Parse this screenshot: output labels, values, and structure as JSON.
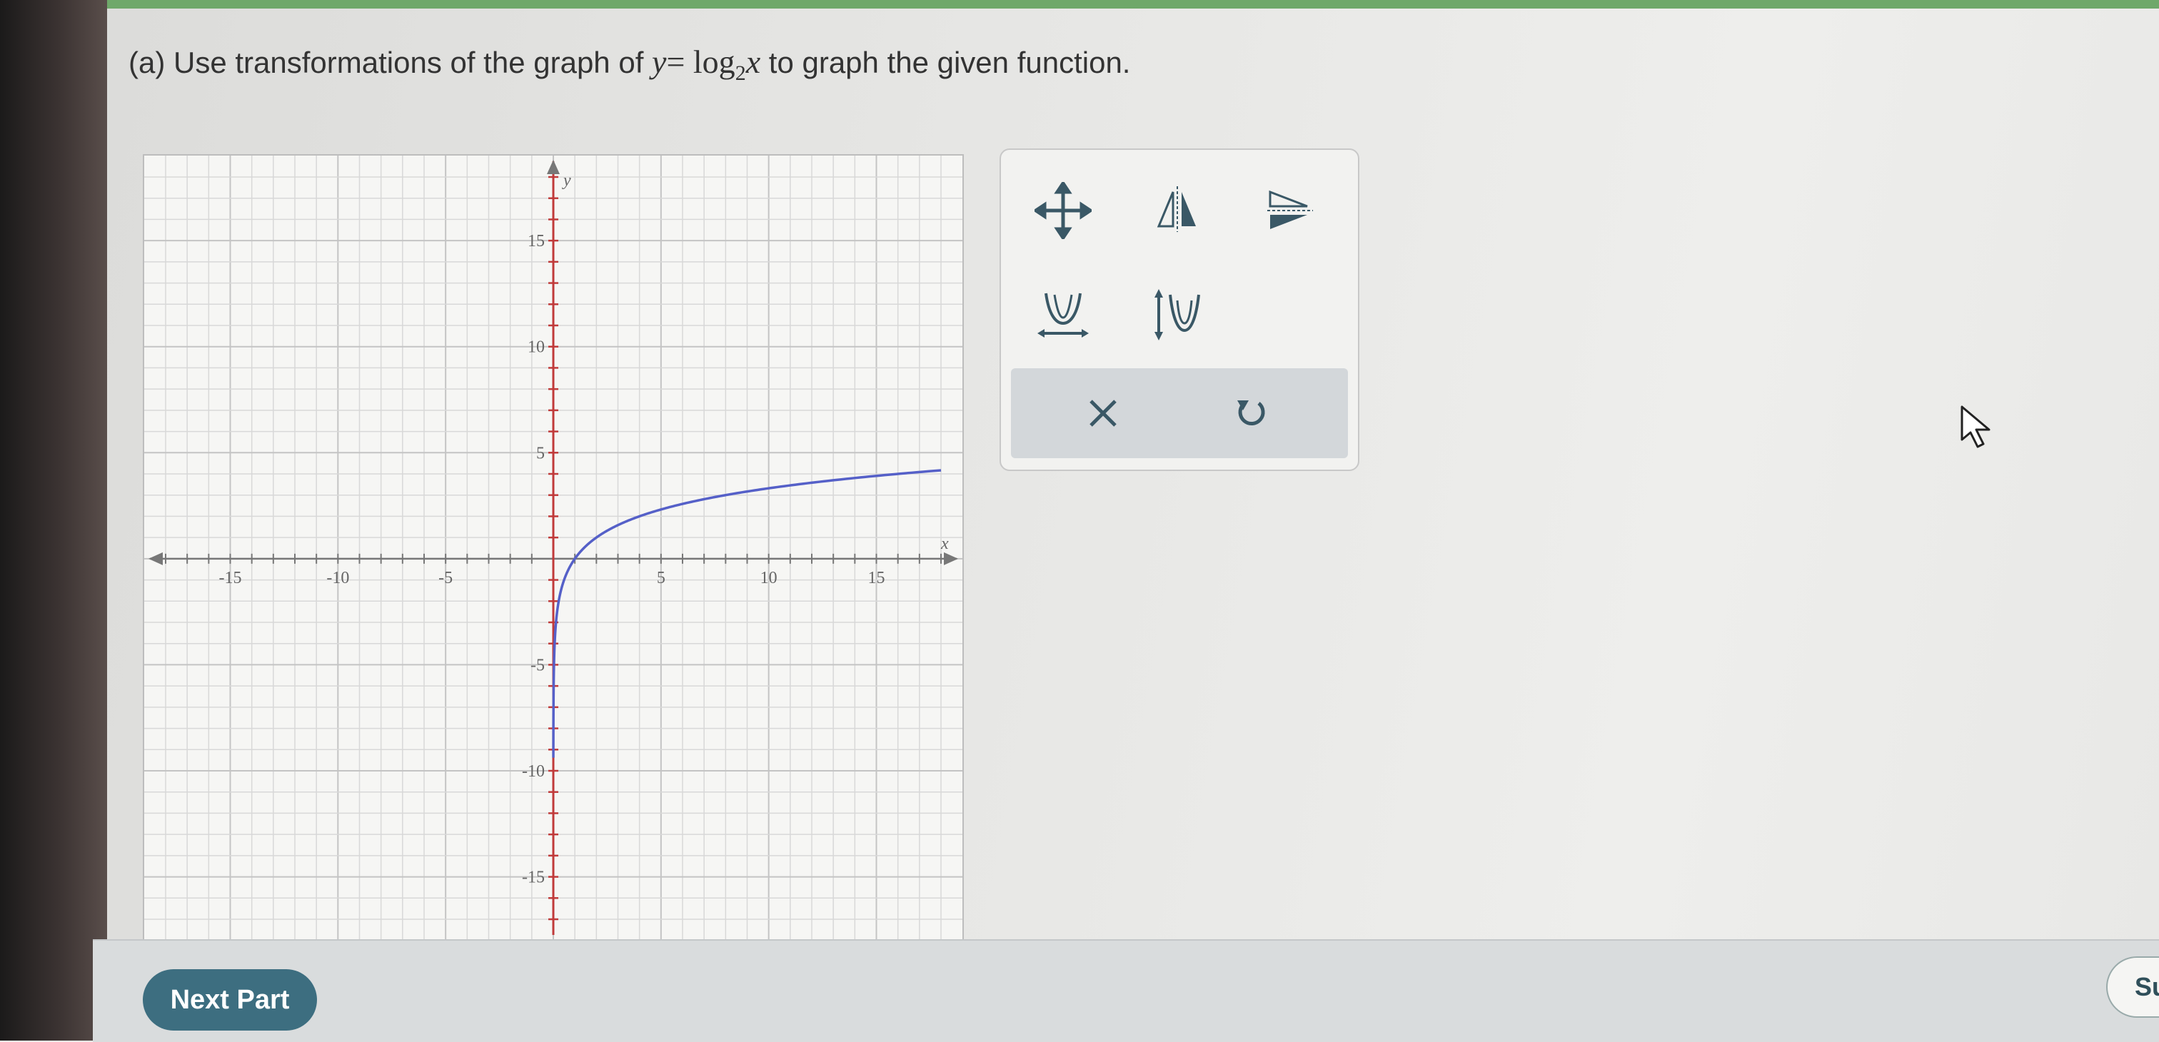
{
  "question": {
    "part": "(a)",
    "text_before": "Use transformations of the graph of",
    "equation_y": "y",
    "equation_eq": "=",
    "equation_log": "log",
    "equation_base": "2",
    "equation_x": "x",
    "text_after": "to graph the given function."
  },
  "toolbar": {
    "tools": [
      {
        "name": "move-tool",
        "icon": "move-arrows-icon"
      },
      {
        "name": "reflect-y-axis-tool",
        "icon": "reflect-vertical-icon"
      },
      {
        "name": "reflect-x-axis-tool",
        "icon": "reflect-horizontal-icon"
      },
      {
        "name": "horizontal-stretch-tool",
        "icon": "horizontal-stretch-icon"
      },
      {
        "name": "vertical-stretch-tool",
        "icon": "vertical-stretch-icon"
      }
    ],
    "clear_icon": "close-icon",
    "undo_icon": "undo-icon"
  },
  "chart_data": {
    "type": "line",
    "title": "",
    "xlabel": "x",
    "ylabel": "y",
    "xlim": [
      -18,
      18
    ],
    "ylim": [
      -17,
      18
    ],
    "x_ticks": [
      -15,
      -10,
      -5,
      5,
      10,
      15
    ],
    "y_ticks": [
      15,
      10,
      5,
      -5,
      -10,
      -15
    ],
    "grid": true,
    "series": [
      {
        "function": "log2(x)",
        "color": "#5560c8",
        "x": [
          0.002,
          0.01,
          0.05,
          0.1,
          0.25,
          0.5,
          1,
          2,
          4,
          8,
          16,
          18
        ],
        "y": [
          -8.97,
          -6.64,
          -4.32,
          -3.32,
          -2,
          -1,
          0,
          1,
          2,
          3,
          4,
          4.17
        ]
      }
    ]
  },
  "buttons": {
    "next_part": "Next Part",
    "submit_partial": "Su"
  },
  "colors": {
    "axis": "#c03a3a",
    "curve": "#5560c8",
    "accent": "#3d6e80"
  }
}
